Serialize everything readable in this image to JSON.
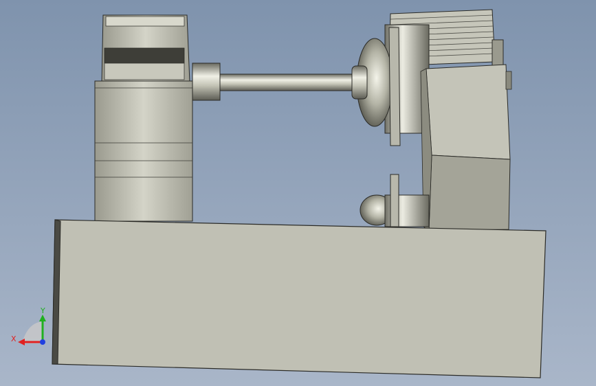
{
  "viewport": {
    "background_top": "#7f93ad",
    "background_bottom": "#a9b6c9"
  },
  "colors": {
    "body_fill": "#c0c0b4",
    "body_dark": "#8a8a7e",
    "body_edge": "#2a2a26",
    "metal_light": "#e6e6dc",
    "metal_mid": "#a8a89a",
    "metal_dark": "#5a5a52",
    "axis_x": "#e02020",
    "axis_y": "#20b020",
    "axis_z": "#2040e0"
  },
  "triad": {
    "x_label": "X",
    "y_label": "Y"
  }
}
